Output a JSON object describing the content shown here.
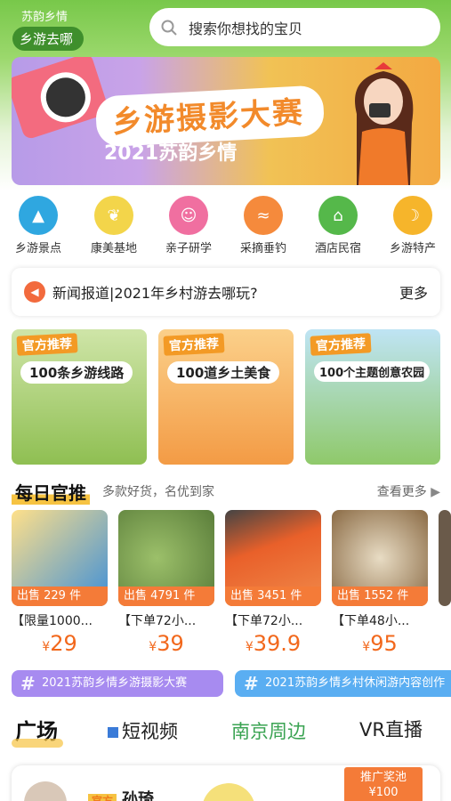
{
  "header": {
    "brand_top": "苏韵乡情",
    "brand_name": "乡游去哪",
    "search_placeholder": "搜索你想找的宝贝"
  },
  "banner": {
    "title": "乡游摄影大赛",
    "subtitle": "2021苏韵乡情"
  },
  "categories": [
    {
      "label": "乡游景点",
      "icon": "mountain-icon",
      "color": "#2fa7e0"
    },
    {
      "label": "康美基地",
      "icon": "wheat-icon",
      "color": "#f3d54a"
    },
    {
      "label": "亲子研学",
      "icon": "family-icon",
      "color": "#f06fa0"
    },
    {
      "label": "采摘垂钓",
      "icon": "fishing-icon",
      "color": "#f58a3c"
    },
    {
      "label": "酒店民宿",
      "icon": "house-icon",
      "color": "#55b84a"
    },
    {
      "label": "乡游特产",
      "icon": "banana-icon",
      "color": "#f6b52b"
    }
  ],
  "news": {
    "text": "新闻报道|2021年乡村游去哪玩?",
    "more": "更多"
  },
  "feature_cards": [
    {
      "tag": "官方推荐",
      "title": "100条乡游线路",
      "color": "#a9cf6a"
    },
    {
      "tag": "官方推荐",
      "title": "100道乡土美食",
      "color": "#f4a44a"
    },
    {
      "tag": "官方推荐",
      "title": "100个主题创意农园",
      "color": "#8fcde8"
    }
  ],
  "daily": {
    "heading": "每日官推",
    "slogan": "多款好货，名优到家",
    "more": "查看更多"
  },
  "products": [
    {
      "sold": "出售 229 件",
      "name": "【限量1000...",
      "currency": "¥",
      "price": "29",
      "color": "#3e8fd8"
    },
    {
      "sold": "出售 4791 件",
      "name": "【下单72小...",
      "currency": "¥",
      "price": "39",
      "color": "#7aa05a"
    },
    {
      "sold": "出售 3451 件",
      "name": "【下单72小...",
      "currency": "¥",
      "price": "39.9",
      "color": "#e9602a"
    },
    {
      "sold": "出售 1552 件",
      "name": "【下单48小...",
      "currency": "¥",
      "price": "95",
      "color": "#b79a6e"
    }
  ],
  "topics": [
    {
      "label": "2021苏韵乡情乡游摄影大赛",
      "color": "#a78bf0"
    },
    {
      "label": "2021苏韵乡情乡村休闲游内容创作",
      "color": "#5aaef2"
    }
  ],
  "tabs": [
    {
      "label": "广场",
      "color": "#111",
      "active": true
    },
    {
      "label": "短视频",
      "color": "#222"
    },
    {
      "label": "南京周边",
      "color": "#3aa352"
    },
    {
      "label": "VR直播",
      "color": "#222"
    }
  ],
  "feed": {
    "tag": "官方",
    "name": "孙琦",
    "badge_line1": "推广奖池",
    "badge_line2": "¥100"
  }
}
